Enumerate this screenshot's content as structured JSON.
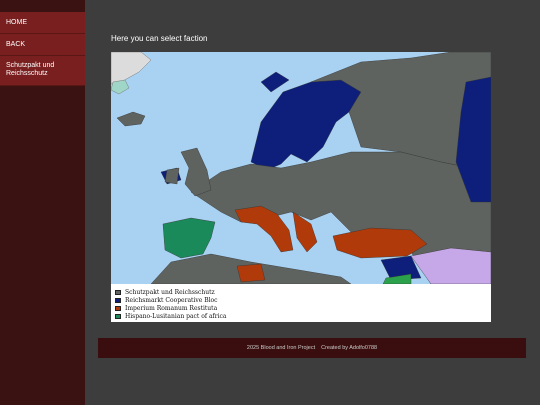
{
  "sidebar": {
    "items": [
      {
        "label": "HOME"
      },
      {
        "label": "BACK"
      },
      {
        "label": "Schutzpakt und Reichsschutz"
      }
    ]
  },
  "main": {
    "title": "Here you can select faction"
  },
  "map": {
    "legend": [
      {
        "label": "Schutzpakt und Reichsschutz",
        "color": "#5e6360"
      },
      {
        "label": "Reichsmarkt Cooperative Bloc",
        "color": "#0d1f7a"
      },
      {
        "label": "Imperium Romanum Restituta",
        "color": "#b03a0a"
      },
      {
        "label": "Hispano-Lusitanian pact of africa",
        "color": "#1a8a5a"
      }
    ],
    "colors": {
      "sea": "#a9d2f2",
      "neutral": "#dcdcdc",
      "other": "#c6a8e8"
    }
  },
  "footer": {
    "project": "2025 Blood and Iron Project",
    "credit": "Created by Adolfo0788"
  }
}
